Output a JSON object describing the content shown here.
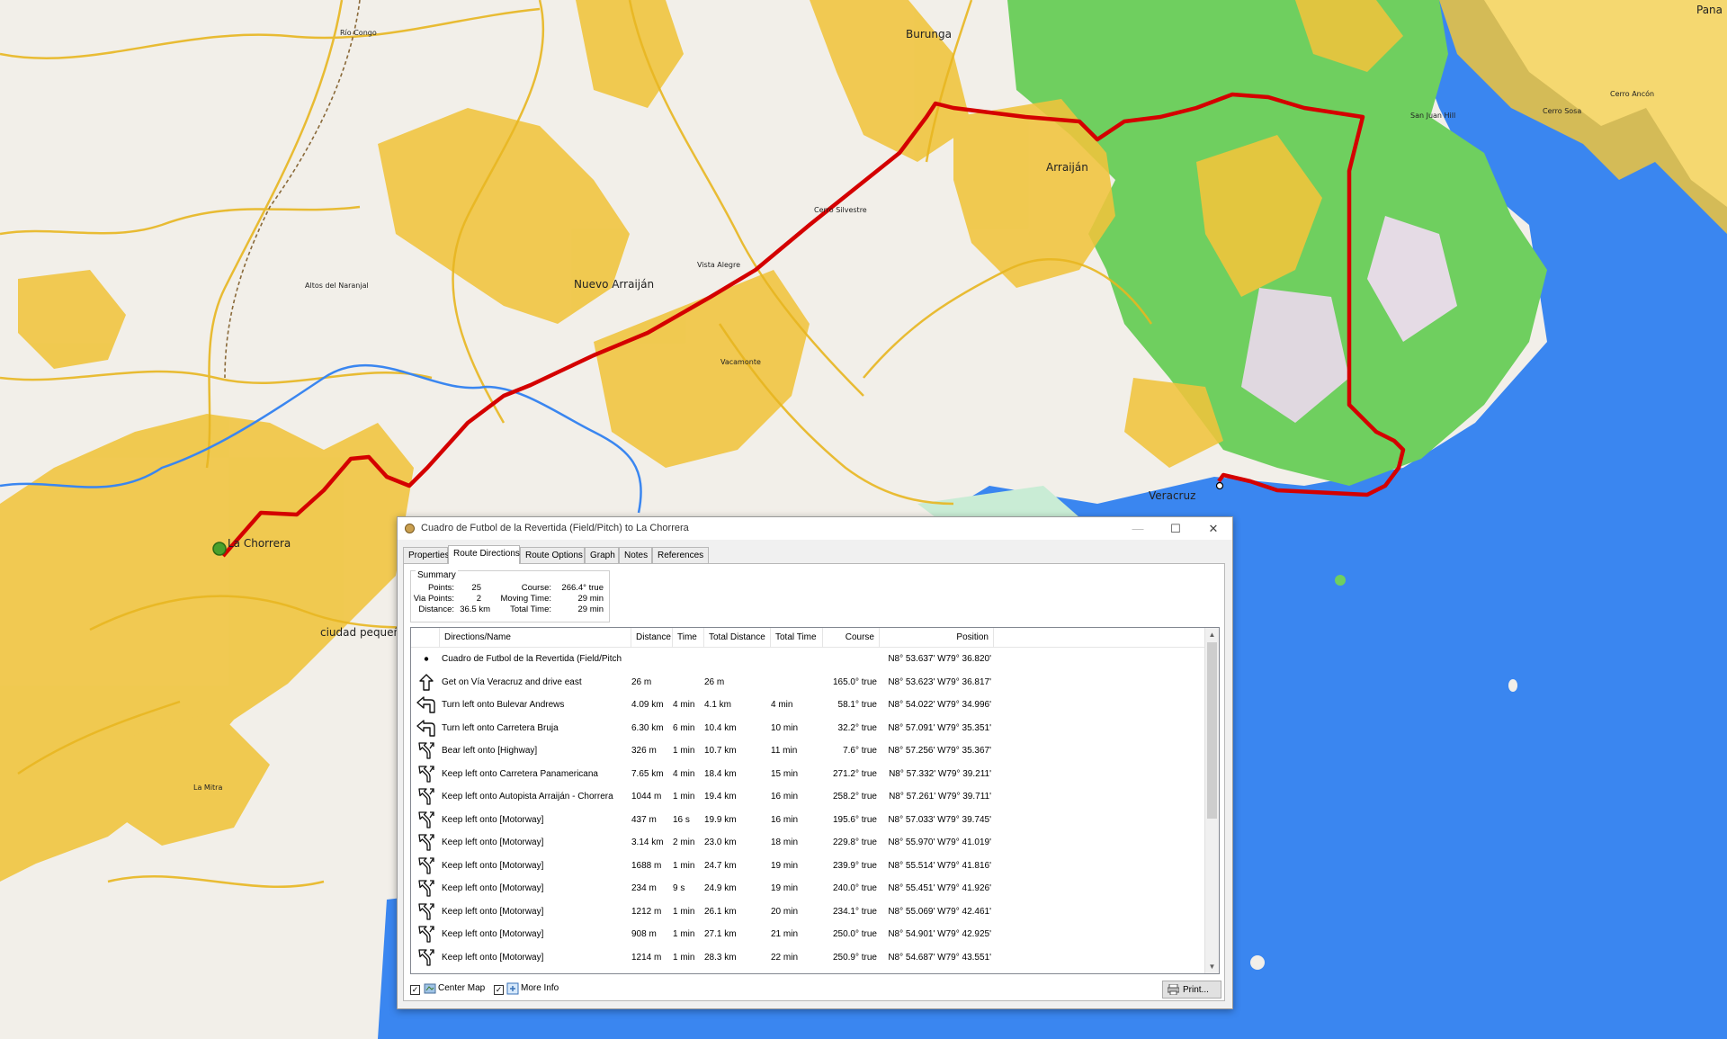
{
  "window": {
    "title": "Cuadro de Futbol de la Revertida (Field/Pitch) to La Chorrera",
    "minimize": "—",
    "maximize": "☐",
    "close": "✕"
  },
  "tabs": [
    {
      "label": "Properties"
    },
    {
      "label": "Route Directions"
    },
    {
      "label": "Route Options"
    },
    {
      "label": "Graph"
    },
    {
      "label": "Notes"
    },
    {
      "label": "References"
    }
  ],
  "summary": {
    "legend": "Summary",
    "points_label": "Points:",
    "points": "25",
    "via_label": "Via Points:",
    "via": "2",
    "distance_label": "Distance:",
    "distance": "36.5 km",
    "course_label": "Course:",
    "course": "266.4° true",
    "moving_label": "Moving Time:",
    "moving": "29 min",
    "total_label": "Total Time:",
    "total": "29 min"
  },
  "columns": [
    "Directions/Name",
    "Distance",
    "Time",
    "Total Distance",
    "Total Time",
    "Course",
    "Position"
  ],
  "rows": [
    {
      "icon": "dot",
      "name": "Cuadro de Futbol de la Revertida (Field/Pitch",
      "distance": "",
      "time": "",
      "total_distance": "",
      "total_time": "",
      "course": "",
      "position": "N8° 53.637' W79° 36.820'"
    },
    {
      "icon": "straight",
      "name": "Get on Vía Veracruz and drive east",
      "distance": "26 m",
      "time": "",
      "total_distance": "26 m",
      "total_time": "",
      "course": "165.0° true",
      "position": "N8° 53.623' W79° 36.817'"
    },
    {
      "icon": "turn-left",
      "name": "Turn left onto Bulevar Andrews",
      "distance": "4.09 km",
      "time": "4 min",
      "total_distance": "4.1 km",
      "total_time": "4 min",
      "course": "58.1° true",
      "position": "N8° 54.022' W79° 34.996'"
    },
    {
      "icon": "turn-left",
      "name": "Turn left onto Carretera Bruja",
      "distance": "6.30 km",
      "time": "6 min",
      "total_distance": "10.4 km",
      "total_time": "10 min",
      "course": "32.2° true",
      "position": "N8° 57.091' W79° 35.351'"
    },
    {
      "icon": "keep-left",
      "name": "Bear left onto [Highway]",
      "distance": "326 m",
      "time": "1 min",
      "total_distance": "10.7 km",
      "total_time": "11 min",
      "course": "7.6° true",
      "position": "N8° 57.256' W79° 35.367'"
    },
    {
      "icon": "keep-left",
      "name": "Keep left onto Carretera Panamericana",
      "distance": "7.65 km",
      "time": "4 min",
      "total_distance": "18.4 km",
      "total_time": "15 min",
      "course": "271.2° true",
      "position": "N8° 57.332' W79° 39.211'"
    },
    {
      "icon": "keep-left",
      "name": "Keep left onto Autopista Arraiján - Chorrera",
      "distance": "1044 m",
      "time": "1 min",
      "total_distance": "19.4 km",
      "total_time": "16 min",
      "course": "258.2° true",
      "position": "N8° 57.261' W79° 39.711'"
    },
    {
      "icon": "keep-left",
      "name": "Keep left onto [Motorway]",
      "distance": "437 m",
      "time": "16 s",
      "total_distance": "19.9 km",
      "total_time": "16 min",
      "course": "195.6° true",
      "position": "N8° 57.033' W79° 39.745'"
    },
    {
      "icon": "keep-left",
      "name": "Keep left onto [Motorway]",
      "distance": "3.14 km",
      "time": "2 min",
      "total_distance": "23.0 km",
      "total_time": "18 min",
      "course": "229.8° true",
      "position": "N8° 55.970' W79° 41.019'"
    },
    {
      "icon": "keep-left",
      "name": "Keep left onto [Motorway]",
      "distance": "1688 m",
      "time": "1 min",
      "total_distance": "24.7 km",
      "total_time": "19 min",
      "course": "239.9° true",
      "position": "N8° 55.514' W79° 41.816'"
    },
    {
      "icon": "keep-left",
      "name": "Keep left onto [Motorway]",
      "distance": "234 m",
      "time": "9 s",
      "total_distance": "24.9 km",
      "total_time": "19 min",
      "course": "240.0° true",
      "position": "N8° 55.451' W79° 41.926'"
    },
    {
      "icon": "keep-left",
      "name": "Keep left onto [Motorway]",
      "distance": "1212 m",
      "time": "1 min",
      "total_distance": "26.1 km",
      "total_time": "20 min",
      "course": "234.1° true",
      "position": "N8° 55.069' W79° 42.461'"
    },
    {
      "icon": "keep-left",
      "name": "Keep left onto [Motorway]",
      "distance": "908 m",
      "time": "1 min",
      "total_distance": "27.1 km",
      "total_time": "21 min",
      "course": "250.0° true",
      "position": "N8° 54.901' W79° 42.925'"
    },
    {
      "icon": "keep-left",
      "name": "Keep left onto [Motorway]",
      "distance": "1214 m",
      "time": "1 min",
      "total_distance": "28.3 km",
      "total_time": "22 min",
      "course": "250.9° true",
      "position": "N8° 54.687' W79° 43.551'"
    }
  ],
  "footer": {
    "center_map": "Center Map",
    "center_map_checked": true,
    "more_info": "More Info",
    "more_info_checked": true,
    "print": "Print..."
  },
  "map_labels": {
    "burunga": "Burunga",
    "arraijan": "Arraiján",
    "nuevo_arraijan": "Nuevo Arraiján",
    "veracruz": "Veracruz",
    "la_chorrera": "La Chorrera",
    "ciudad": "ciudad pequeñ",
    "rio_congo": "Río Congo",
    "altos": "Altos del Naranjal",
    "cerro_silvestre": "Cerro Silvestre",
    "vista_alegre": "Vista Alegre",
    "vacamonte": "Vacamonte",
    "la_mitra": "La Mitra",
    "san_juan": "San Juan Hill",
    "cerro_sosa": "Cerro Sosa",
    "cerro_ancon": "Cerro Ancón",
    "pana": "Pana"
  },
  "colors": {
    "route": "#d40000",
    "land": "#f2efe9",
    "roads": "#f0c43c",
    "forest": "#6fcf5f",
    "water": "#3a86f0"
  }
}
